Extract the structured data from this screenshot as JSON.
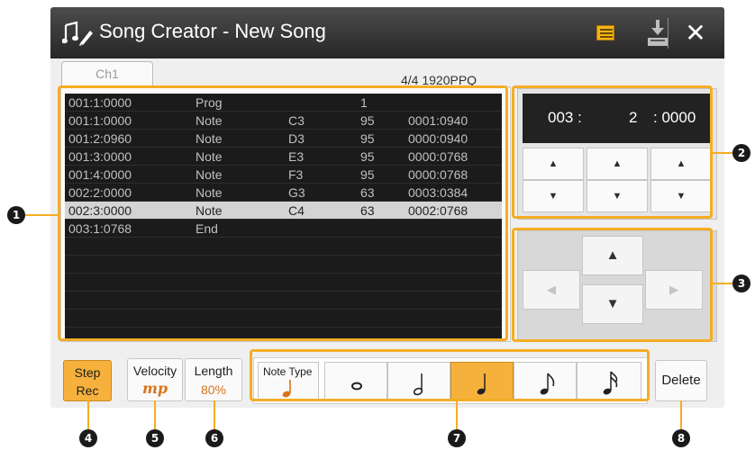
{
  "window": {
    "title": "Song Creator - New Song",
    "close_glyph": "✕",
    "icons": {
      "title": "music-note-edit-icon",
      "list": "list-icon",
      "save": "save-download-icon",
      "close": "close-icon"
    }
  },
  "tab": {
    "label": "Ch1"
  },
  "time_signature": "4/4  1920PPQ",
  "events": [
    {
      "position": "001:1:0000",
      "type": "Prog",
      "d1": "",
      "d2": "1",
      "d3": ""
    },
    {
      "position": "001:1:0000",
      "type": "Note",
      "d1": "C3",
      "d2": "95",
      "d3": "0001:0940"
    },
    {
      "position": "001:2:0960",
      "type": "Note",
      "d1": "D3",
      "d2": "95",
      "d3": "0000:0940"
    },
    {
      "position": "001:3:0000",
      "type": "Note",
      "d1": "E3",
      "d2": "95",
      "d3": "0000:0768"
    },
    {
      "position": "001:4:0000",
      "type": "Note",
      "d1": "F3",
      "d2": "95",
      "d3": "0000:0768"
    },
    {
      "position": "002:2:0000",
      "type": "Note",
      "d1": "G3",
      "d2": "63",
      "d3": "0003:0384"
    },
    {
      "position": "002:3:0000",
      "type": "Note",
      "d1": "C4",
      "d2": "63",
      "d3": "0002:0768"
    },
    {
      "position": "003:1:0768",
      "type": "End",
      "d1": "",
      "d2": "",
      "d3": ""
    }
  ],
  "selected_event_index": 6,
  "position": {
    "bar": "003",
    "bar_sep": ":",
    "beat": "2",
    "beat_sep": ":",
    "tick": "0000"
  },
  "glyphs": {
    "up": "▲",
    "down": "▼",
    "left": "◀",
    "right": "▶"
  },
  "buttons": {
    "step_rec_line1": "Step",
    "step_rec_line2": "Rec",
    "velocity_label": "Velocity",
    "velocity_value": "mp",
    "length_label": "Length",
    "length_value": "80%",
    "note_type_label": "Note Type",
    "delete_label": "Delete"
  },
  "note_types": [
    "whole-note",
    "half-note",
    "quarter-note",
    "eighth-note",
    "sixteenth-note"
  ],
  "selected_note_type": "quarter-note",
  "callouts": [
    "1",
    "2",
    "3",
    "4",
    "5",
    "6",
    "7",
    "8"
  ],
  "colors": {
    "accent": "#f6b13c",
    "highlight": "#f4ad25",
    "titlebar": "#3a3a3a",
    "list_bg": "#1b1b1b",
    "value_orange": "#d9741a"
  }
}
